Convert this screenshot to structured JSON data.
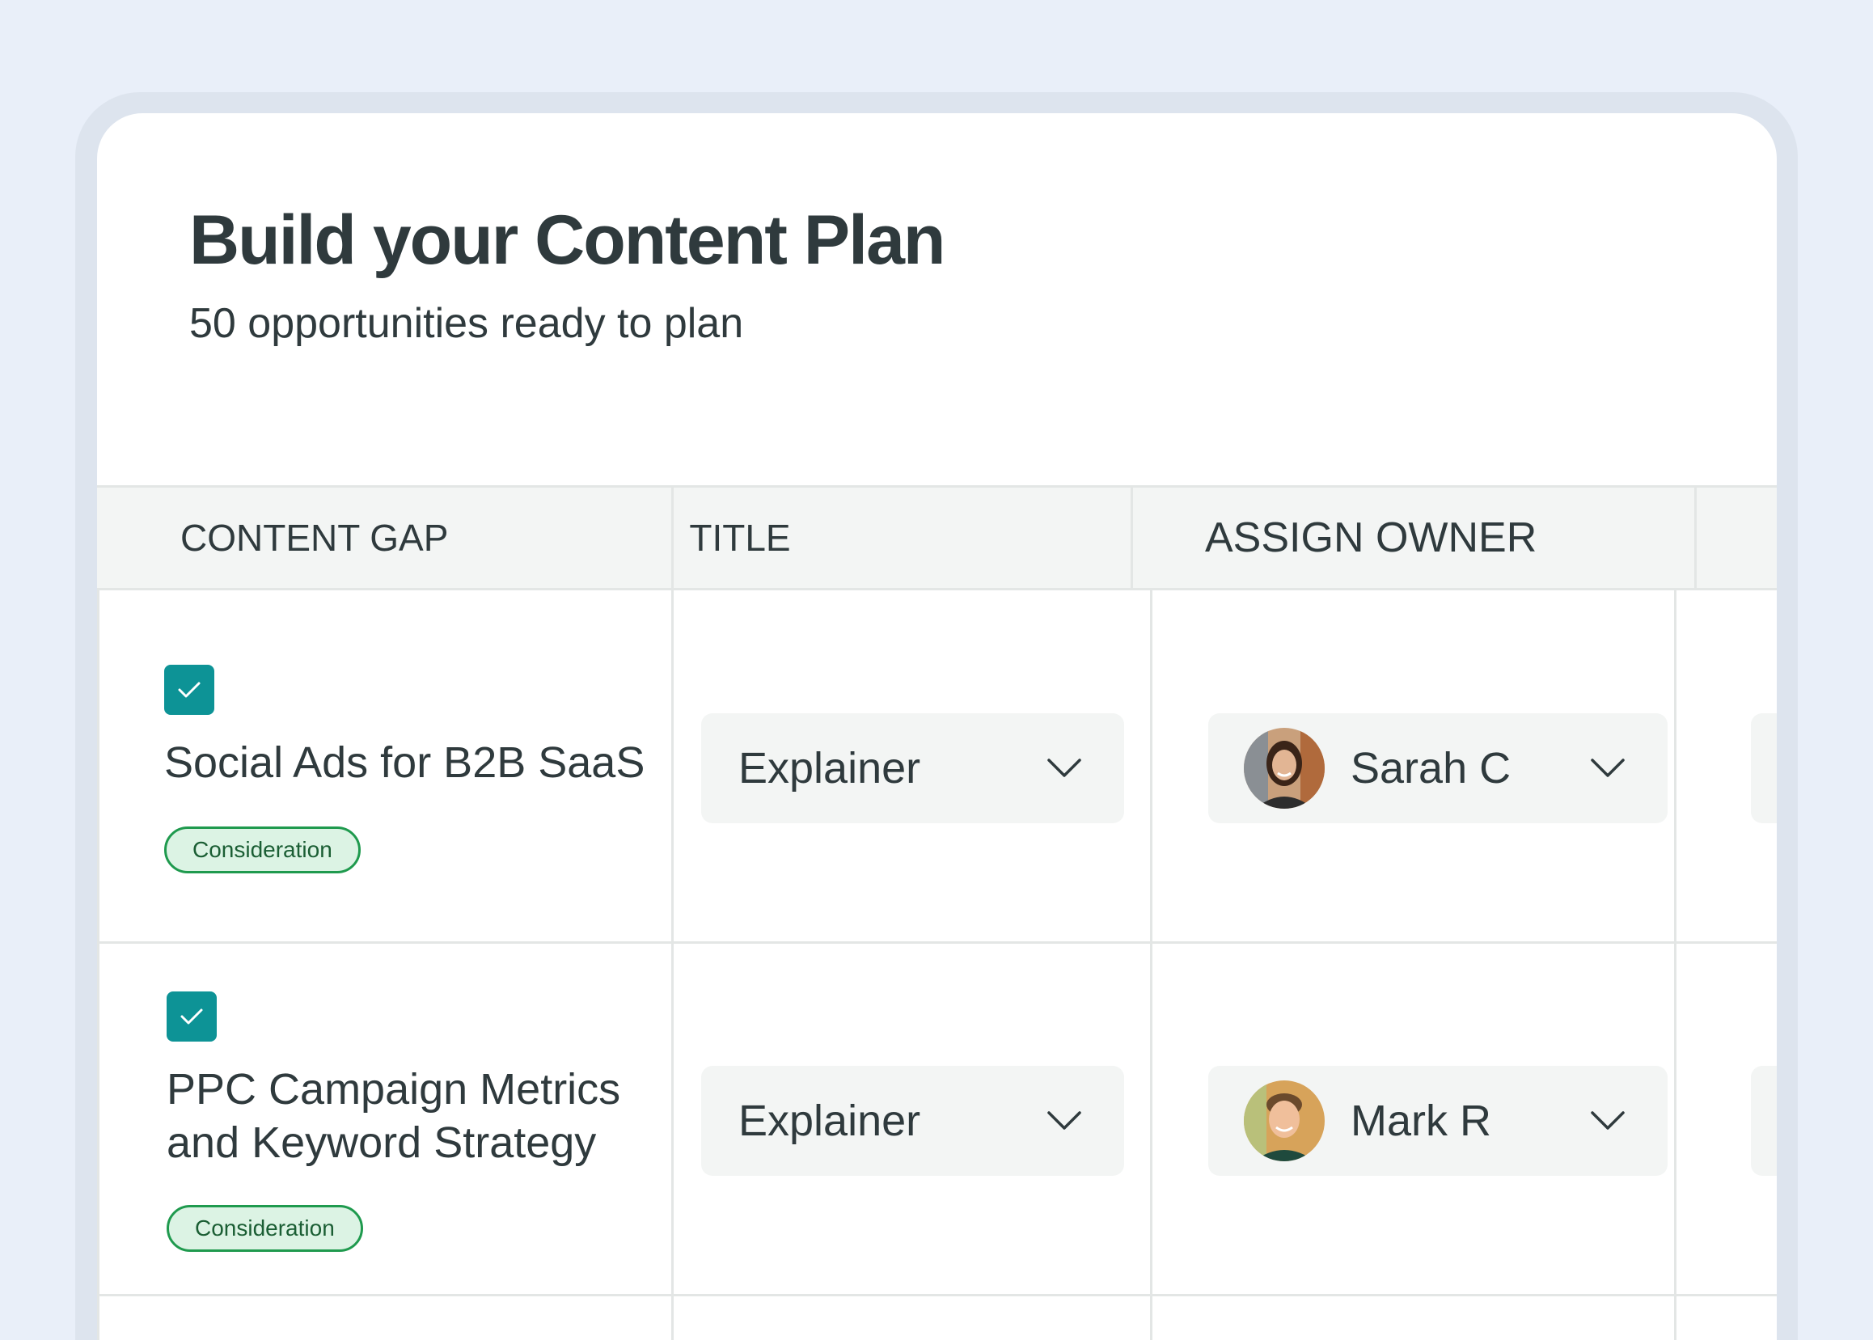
{
  "page": {
    "title": "Build your Content Plan",
    "subtitle": "50 opportunities ready to plan"
  },
  "table": {
    "columns": [
      "CONTENT GAP",
      "TITLE",
      "ASSIGN OWNER"
    ],
    "rows": [
      {
        "checked": true,
        "gap_lines": [
          "Social Ads for B2B SaaS"
        ],
        "stage": "Consideration",
        "title_type": "Explainer",
        "owner": "Sarah C",
        "avatar_icon": "woman-avatar-icon"
      },
      {
        "checked": true,
        "gap_lines": [
          "PPC Campaign Metrics",
          "and Keyword Strategy"
        ],
        "stage": "Consideration",
        "title_type": "Explainer",
        "owner": "Mark R",
        "avatar_icon": "man-avatar-icon"
      }
    ]
  },
  "colors": {
    "page_bg": "#e9eff9",
    "frame": "#dde4ee",
    "checkbox": "#0d9396",
    "badge_border": "#1f9a4e",
    "badge_bg": "#dcf3e4",
    "header_bg": "#f3f5f4",
    "text": "#2f3a3d"
  }
}
